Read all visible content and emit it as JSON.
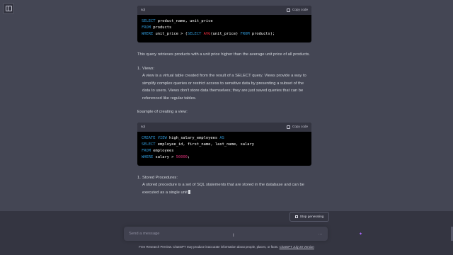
{
  "sidebar": {
    "toggle_icon": "sidebar-toggle-icon"
  },
  "code_blocks": [
    {
      "language": "sql",
      "copy_label": "Copy code",
      "lines": [
        [
          {
            "t": "SELECT",
            "c": "kw"
          },
          {
            "t": " product_name, unit_price",
            "c": ""
          }
        ],
        [
          {
            "t": "FROM",
            "c": "kw"
          },
          {
            "t": " products",
            "c": ""
          }
        ],
        [
          {
            "t": "WHERE",
            "c": "kw"
          },
          {
            "t": " unit_price > (",
            "c": ""
          },
          {
            "t": "SELECT",
            "c": "kw"
          },
          {
            "t": " ",
            "c": ""
          },
          {
            "t": "AVG",
            "c": "fn"
          },
          {
            "t": "(unit_price) ",
            "c": ""
          },
          {
            "t": "FROM",
            "c": "kw"
          },
          {
            "t": " products);",
            "c": ""
          }
        ]
      ]
    },
    {
      "language": "sql",
      "copy_label": "Copy code",
      "lines": [
        [
          {
            "t": "CREATE",
            "c": "kw"
          },
          {
            "t": " ",
            "c": ""
          },
          {
            "t": "VIEW",
            "c": "kw"
          },
          {
            "t": " high_salary_employees ",
            "c": ""
          },
          {
            "t": "AS",
            "c": "kw"
          }
        ],
        [
          {
            "t": "SELECT",
            "c": "kw"
          },
          {
            "t": " employee_id, first_name, last_name, salary",
            "c": ""
          }
        ],
        [
          {
            "t": "FROM",
            "c": "kw"
          },
          {
            "t": " employees",
            "c": ""
          }
        ],
        [
          {
            "t": "WHERE",
            "c": "kw"
          },
          {
            "t": " salary > ",
            "c": ""
          },
          {
            "t": "50000",
            "c": "num"
          },
          {
            "t": ";",
            "c": ""
          }
        ]
      ]
    }
  ],
  "message": {
    "after_code_1": "This query retrieves products with a unit price higher than the average unit price of all products.",
    "item_views": {
      "number": "1.",
      "title": "Views:",
      "body": "A view is a virtual table created from the result of a SELECT query. Views provide a way to simplify complex queries or restrict access to sensitive data by presenting a subset of the data to users. Views don't store data themselves; they are just saved queries that can be referenced like regular tables."
    },
    "example_label": "Example of creating a view:",
    "item_procedures": {
      "number": "1.",
      "title": "Stored Procedures:",
      "body": "A stored procedure is a set of SQL statements that are stored in the database and can be executed as a single unit"
    }
  },
  "controls": {
    "stop_label": "Stop generating",
    "input_placeholder": "Send a message",
    "ellipsis": "...",
    "text_cursor_glyph": "I",
    "sparkle_glyph": "✦"
  },
  "footer": {
    "text": "Free Research Preview. ChatGPT may produce inaccurate information about people, places, or facts. ",
    "link": "ChatGPT July 20 Version"
  },
  "colors": {
    "background": "#444654",
    "code_bg": "#000000",
    "keyword": "#2e95d3",
    "function": "#f22c3d",
    "number": "#df3079"
  }
}
